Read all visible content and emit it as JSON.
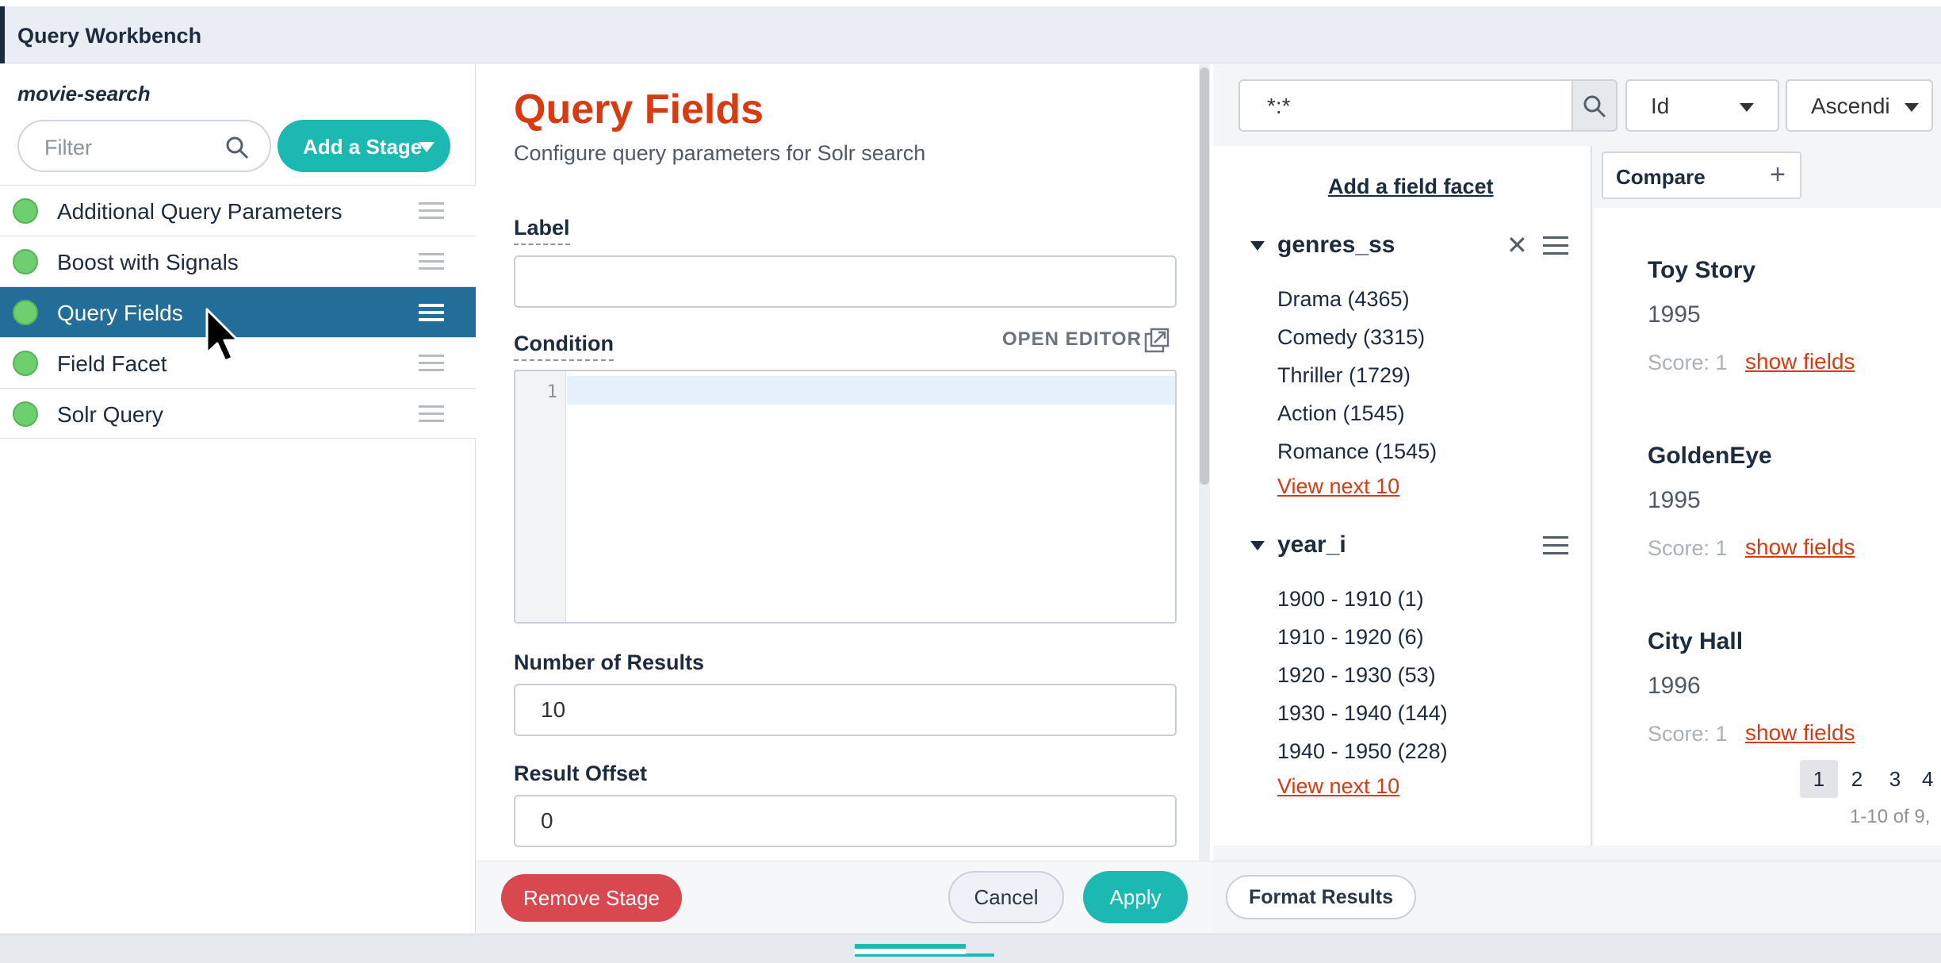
{
  "app": {
    "title": "Query Workbench"
  },
  "sidebar": {
    "pipeline_name": "movie-search",
    "filter_placeholder": "Filter",
    "add_stage_label": "Add a Stage",
    "stages": [
      {
        "label": "Additional Query Parameters",
        "active": false
      },
      {
        "label": "Boost with Signals",
        "active": false
      },
      {
        "label": "Query Fields",
        "active": true
      },
      {
        "label": "Field Facet",
        "active": false
      },
      {
        "label": "Solr Query",
        "active": false
      }
    ]
  },
  "stage_panel": {
    "title": "Query Fields",
    "subtitle": "Configure query parameters for Solr search",
    "label_field": {
      "label": "Label",
      "value": ""
    },
    "condition_field": {
      "label": "Condition",
      "open_editor": "OPEN EDITOR",
      "line_number": "1"
    },
    "num_results": {
      "label": "Number of Results",
      "value": "10"
    },
    "result_offset": {
      "label": "Result Offset",
      "value": "0"
    },
    "footer": {
      "remove": "Remove Stage",
      "cancel": "Cancel",
      "apply": "Apply"
    }
  },
  "results": {
    "query": "*:*",
    "sort_field": "Id",
    "sort_order": "Ascendi",
    "add_facet": "Add a field facet",
    "facets": [
      {
        "name": "genres_ss",
        "items": [
          "Drama (4365)",
          "Comedy (3315)",
          "Thriller (1729)",
          "Action (1545)",
          "Romance (1545)"
        ],
        "more": "View next 10"
      },
      {
        "name": "year_i",
        "items": [
          "1900 - 1910 (1)",
          "1910 - 1920 (6)",
          "1920 - 1930 (53)",
          "1930 - 1940 (144)",
          "1940 - 1950 (228)"
        ],
        "more": "View next 10"
      }
    ],
    "compare_label": "Compare",
    "docs": [
      {
        "title": "Toy Story",
        "year": "1995",
        "score": "Score: 1",
        "show": "show fields"
      },
      {
        "title": "GoldenEye",
        "year": "1995",
        "score": "Score: 1",
        "show": "show fields"
      },
      {
        "title": "City Hall",
        "year": "1996",
        "score": "Score: 1",
        "show": "show fields"
      }
    ],
    "pages": [
      "1",
      "2",
      "3",
      "4"
    ],
    "current_page": "1",
    "range": "1-10 of 9,",
    "format_results": "Format Results"
  },
  "colors": {
    "accent": "#1cb9b3",
    "title_red": "#d83b12",
    "active_stage": "#226e99",
    "danger": "#d9484f"
  },
  "icons": {
    "search": "search-icon",
    "drag": "drag-handle-icon",
    "external": "open-external-icon",
    "close": "close-icon",
    "menu": "menu-icon"
  }
}
